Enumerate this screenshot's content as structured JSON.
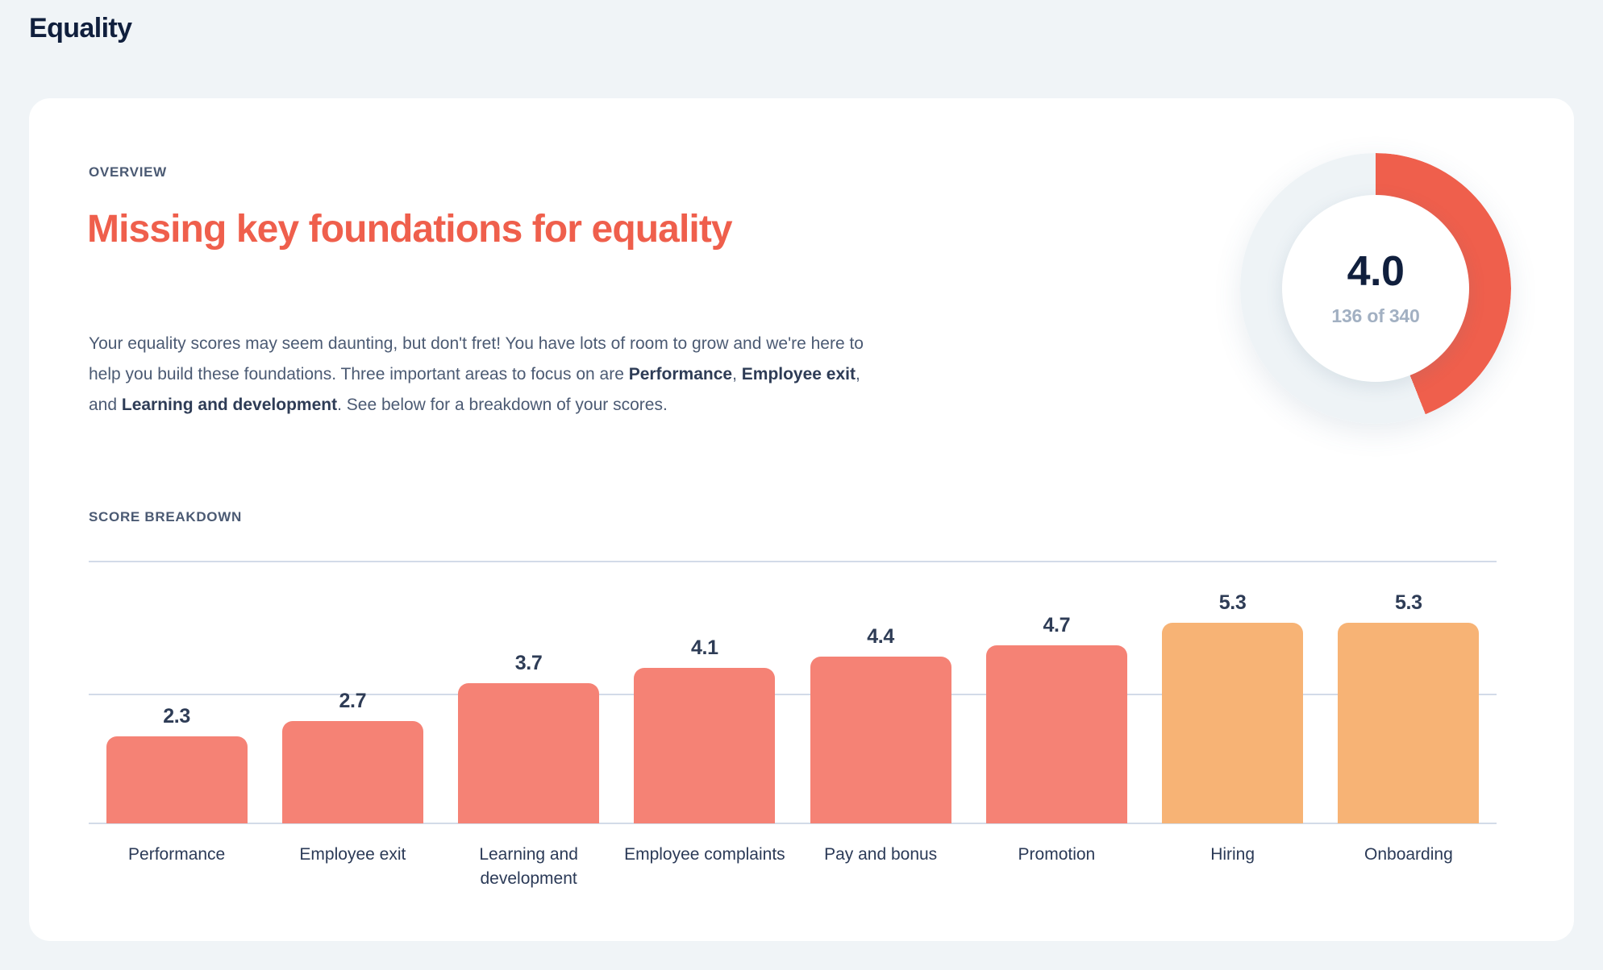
{
  "page": {
    "title": "Equality",
    "background_color": "#F0F4F7",
    "card_color": "#FFFFFF"
  },
  "overview": {
    "eyebrow": "OVERVIEW",
    "headline": "Missing key foundations for equality",
    "headline_color": "#EF5F4C",
    "body": {
      "part1": "Your equality scores may seem daunting, but don't fret! You have lots of room to grow and we're here to help you build these foundations. Three important areas to focus on are ",
      "bold1": "Performance",
      "sep1": ", ",
      "bold2": "Employee exit",
      "sep2": ", and ",
      "bold3": "Learning and development",
      "part2": ". See below for a breakdown of your scores."
    }
  },
  "score_gauge": {
    "score": "4.0",
    "detail": "136 of 340",
    "percent": 44,
    "arc_color": "#EF5F4C",
    "track_color": "#EEF3F6",
    "score_color": "#101F3D",
    "detail_color": "#A2B0C2"
  },
  "breakdown": {
    "eyebrow": "SCORE BREAKDOWN"
  },
  "chart_data": {
    "type": "bar",
    "title": "SCORE BREAKDOWN",
    "xlabel": "",
    "ylabel": "",
    "ylim": [
      0,
      6
    ],
    "grid": true,
    "gridlines": [
      5
    ],
    "legend": "none",
    "value_label_color": "#2E3C56",
    "categories": [
      "Performance",
      "Employee exit",
      "Learning and development",
      "Employee complaints",
      "Pay and bonus",
      "Promotion",
      "Hiring",
      "Onboarding"
    ],
    "values": [
      2.3,
      2.7,
      3.7,
      4.1,
      4.4,
      4.7,
      5.3,
      5.3
    ],
    "bar_colors": [
      "#F58275",
      "#F58275",
      "#F58275",
      "#F58275",
      "#F58275",
      "#F58275",
      "#F7B375",
      "#F7B375"
    ]
  }
}
